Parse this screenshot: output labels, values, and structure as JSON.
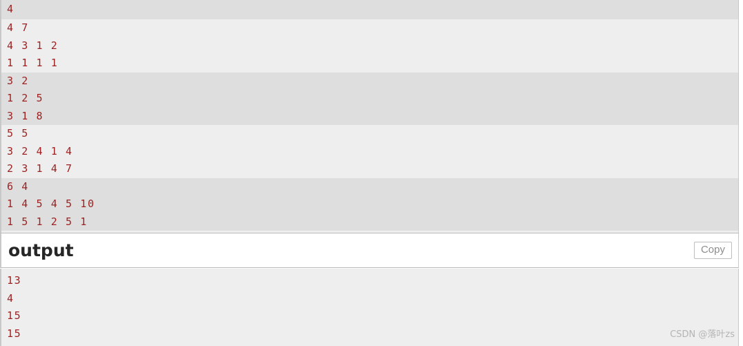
{
  "input_panel": {
    "name": "testcase-input",
    "lines": [
      "4",
      "4 7",
      "4 3 1 2",
      "1 1 1 1",
      "3 2",
      "1 2 5",
      "3 1 8",
      "5 5",
      "3 2 4 1 4",
      "2 3 1 4 7",
      "6 4",
      "1 4 5 4 5 10",
      "1 5 1 2 5 1"
    ],
    "groups": [
      {
        "shaded": true,
        "lines": [
          "4"
        ]
      },
      {
        "shaded": false,
        "lines": [
          "4 7",
          "4 3 1 2",
          "1 1 1 1"
        ]
      },
      {
        "shaded": true,
        "lines": [
          "3 2",
          "1 2 5",
          "3 1 8"
        ]
      },
      {
        "shaded": false,
        "lines": [
          "5 5",
          "3 2 4 1 4",
          "2 3 1 4 7"
        ]
      },
      {
        "shaded": true,
        "lines": [
          "6 4",
          "1 4 5 4 5 10",
          "1 5 1 2 5 1"
        ]
      }
    ]
  },
  "output_header": {
    "title": "output",
    "copy_label": "Copy"
  },
  "output_panel": {
    "lines": [
      "13",
      "4",
      "15",
      "15"
    ]
  },
  "watermark": {
    "text": "CSDN @落叶zs"
  },
  "colors": {
    "code_text": "#9d1f1f",
    "stripe_light": "#eeeeee",
    "stripe_dark": "#dedede",
    "panel_border": "#c8c8c8",
    "header_bg": "#ffffff",
    "title_text": "#262626",
    "copy_text": "#8d8d8d",
    "watermark_text": "#b4b4b4"
  }
}
